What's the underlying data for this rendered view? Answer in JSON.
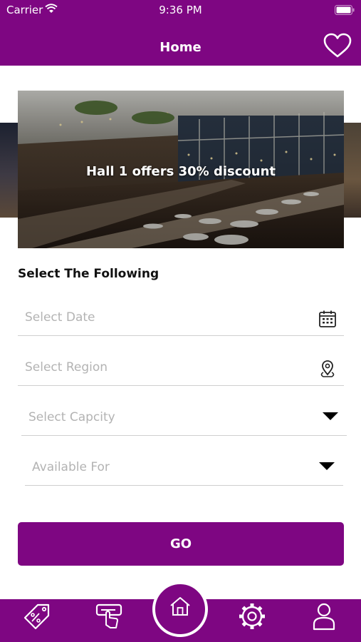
{
  "status_bar": {
    "carrier": "Carrier",
    "time": "9:36 PM"
  },
  "header": {
    "title": "Home",
    "favorite_icon": "heart-outline-icon"
  },
  "banner": {
    "caption": "Hall 1 offers 30% discount"
  },
  "form": {
    "section_title": "Select The Following",
    "date_placeholder": "Select Date",
    "region_placeholder": "Select Region",
    "capacity_placeholder": "Select Capcity",
    "available_placeholder": "Available For",
    "go_label": "GO"
  },
  "tabbar": {
    "items": [
      "discount-tag-icon",
      "booking-touch-icon",
      "home-icon",
      "settings-gear-icon",
      "profile-user-icon"
    ],
    "active": "home"
  },
  "colors": {
    "brand": "#7e0682",
    "placeholder": "#b3b3b3",
    "divider": "#cfcfcf"
  }
}
